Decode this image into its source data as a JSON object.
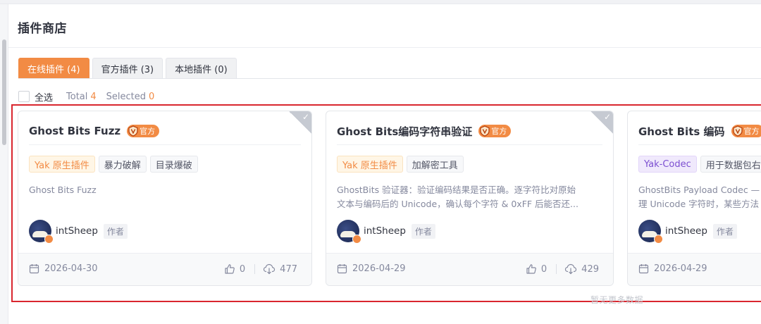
{
  "page_title": "插件商店",
  "tabs": [
    {
      "label": "在线插件 (4)",
      "active": true
    },
    {
      "label": "官方插件 (3)",
      "active": false
    },
    {
      "label": "本地插件 (0)",
      "active": false
    }
  ],
  "selection": {
    "select_all_label": "全选",
    "total_label": "Total",
    "total_value": "4",
    "selected_label": "Selected",
    "selected_value": "0"
  },
  "official_badge_label": "官方",
  "plugins": [
    {
      "title": "Ghost Bits Fuzz",
      "tags": [
        "Yak 原生插件",
        "暴力破解",
        "目录爆破"
      ],
      "description": [
        "Ghost Bits Fuzz"
      ],
      "author": "intSheep",
      "author_role": "作者",
      "date": "2026-04-30",
      "likes": "0",
      "downloads": "477"
    },
    {
      "title": "Ghost Bits编码字符串验证",
      "tags": [
        "Yak 原生插件",
        "加解密工具"
      ],
      "description": [
        "GhostBits 验证器：验证编码结果是否正确。逐字符比对原始",
        "文本与编码后的 Unicode，确认每个字符 & 0xFF 后能否还..."
      ],
      "author": "intSheep",
      "author_role": "作者",
      "date": "2026-04-29",
      "likes": "0",
      "downloads": "429"
    },
    {
      "title": "Ghost Bits 编码",
      "tags": [
        "Yak-Codec",
        "用于数据包右"
      ],
      "description": [
        "GhostBits Payload Codec —",
        "理 Unicode 字符时，某些方法"
      ],
      "author": "intSheep",
      "author_role": "作者",
      "date": "2026-04-29"
    }
  ],
  "no_more_text": "暂无更多数据",
  "colors": {
    "accent": "#f28b44",
    "highlight_frame": "#d9262e",
    "codec_tag": "#7c4fd1"
  }
}
